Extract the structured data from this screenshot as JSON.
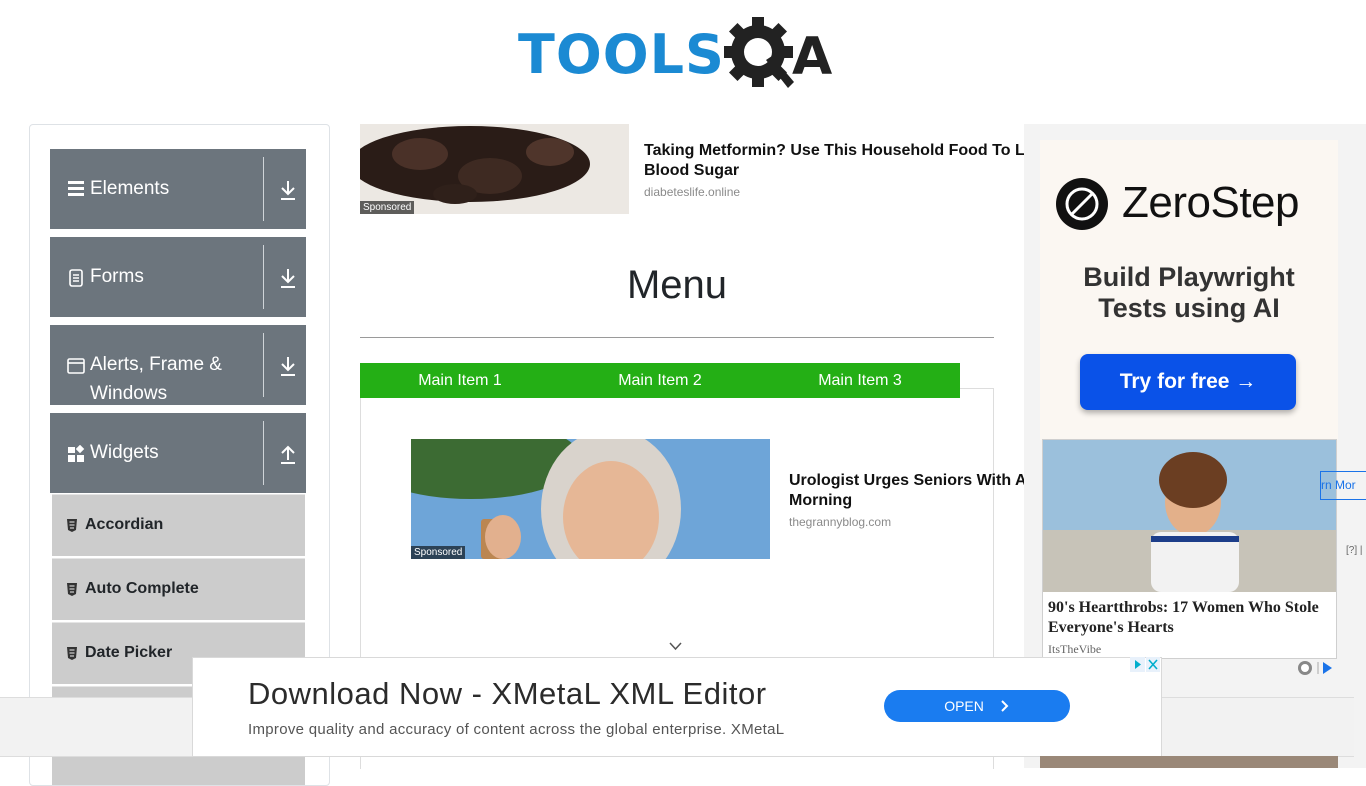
{
  "logo": {
    "tools_text": "TOOLS",
    "qa_text": "A"
  },
  "sidebar": {
    "groups": [
      {
        "label": "Elements",
        "icon": "hamburger-icon",
        "arrow": "download-icon"
      },
      {
        "label": "Forms",
        "icon": "document-icon",
        "arrow": "download-icon"
      },
      {
        "label": "Alerts, Frame &",
        "label2": "Windows",
        "icon": "window-icon",
        "arrow": "download-icon"
      },
      {
        "label": "Widgets",
        "icon": "widgets-icon",
        "arrow": "upload-icon"
      }
    ],
    "items": [
      {
        "label": "Accordian"
      },
      {
        "label": "Auto Complete"
      },
      {
        "label": "Date Picker"
      }
    ]
  },
  "ads": {
    "top": {
      "title_line1": "Taking Metformin? Use This Household Food To L",
      "title_line2": "Blood Sugar",
      "source": "diabeteslife.online",
      "sponsored": "Sponsored"
    },
    "middle": {
      "title_line1": "Urologist Urges Seniors With A",
      "title_line2": "Morning",
      "source": "thegrannyblog.com",
      "sponsored": "Sponsored"
    },
    "zerostep": {
      "name": "ZeroStep",
      "tagline1": "Build Playwright",
      "tagline2": "Tests using AI",
      "button": "Try for free →"
    },
    "heartthrob": {
      "title": "90's Heartthrobs: 17 Women Who Stole Everyone's Hearts",
      "source": "ItsTheVibe"
    },
    "learn_more": "rn Mor",
    "qmark": "[?] |",
    "banner": {
      "title": "Download Now - XMetaL XML Editor",
      "subtitle": "Improve quality and accuracy of content across the global enterprise. XMetaL",
      "button": "OPEN"
    }
  },
  "main": {
    "title": "Menu",
    "nav": [
      "Main Item 1",
      "Main Item 2",
      "Main Item 3"
    ]
  },
  "colors": {
    "nav_green": "#24af15",
    "sidebar_group": "#6c757d",
    "sidebar_item": "#cccccc",
    "logo_blue": "#1b8ad3"
  }
}
